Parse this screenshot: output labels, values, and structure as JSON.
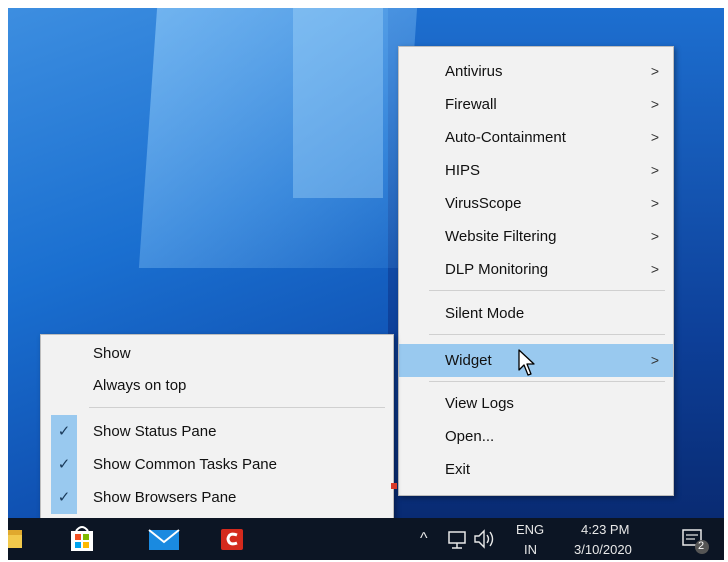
{
  "menu": {
    "items": [
      {
        "label": "Antivirus",
        "submenu": true
      },
      {
        "label": "Firewall",
        "submenu": true
      },
      {
        "label": "Auto-Containment",
        "submenu": true
      },
      {
        "label": "HIPS",
        "submenu": true
      },
      {
        "label": "VirusScope",
        "submenu": true
      },
      {
        "label": "Website Filtering",
        "submenu": true
      },
      {
        "label": "DLP Monitoring",
        "submenu": true
      },
      {
        "label": "Silent Mode",
        "submenu": false
      },
      {
        "label": "Widget",
        "submenu": true,
        "highlighted": true
      },
      {
        "label": "View Logs",
        "submenu": false
      },
      {
        "label": "Open...",
        "submenu": false
      },
      {
        "label": "Exit",
        "submenu": false
      }
    ],
    "chevron": ">"
  },
  "widget_submenu": {
    "items": [
      {
        "label": "Show",
        "checked": false
      },
      {
        "label": "Always on top",
        "checked": false
      },
      {
        "label": "Show Status Pane",
        "checked": true
      },
      {
        "label": "Show Common Tasks Pane",
        "checked": true
      },
      {
        "label": "Show Browsers Pane",
        "checked": true
      }
    ],
    "check": "✓"
  },
  "taskbar": {
    "icons": [
      "file-explorer-icon",
      "store-icon",
      "mail-icon",
      "comodo-icon"
    ],
    "tray": {
      "chevron": "^",
      "lang_top": "ENG",
      "lang_bottom": "IN",
      "time": "4:23 PM",
      "date": "3/10/2020",
      "notification_count": "2"
    }
  },
  "colors": {
    "menu_bg": "#f2f2f2",
    "highlight": "#99c9ef",
    "taskbar": "#0c1524"
  }
}
